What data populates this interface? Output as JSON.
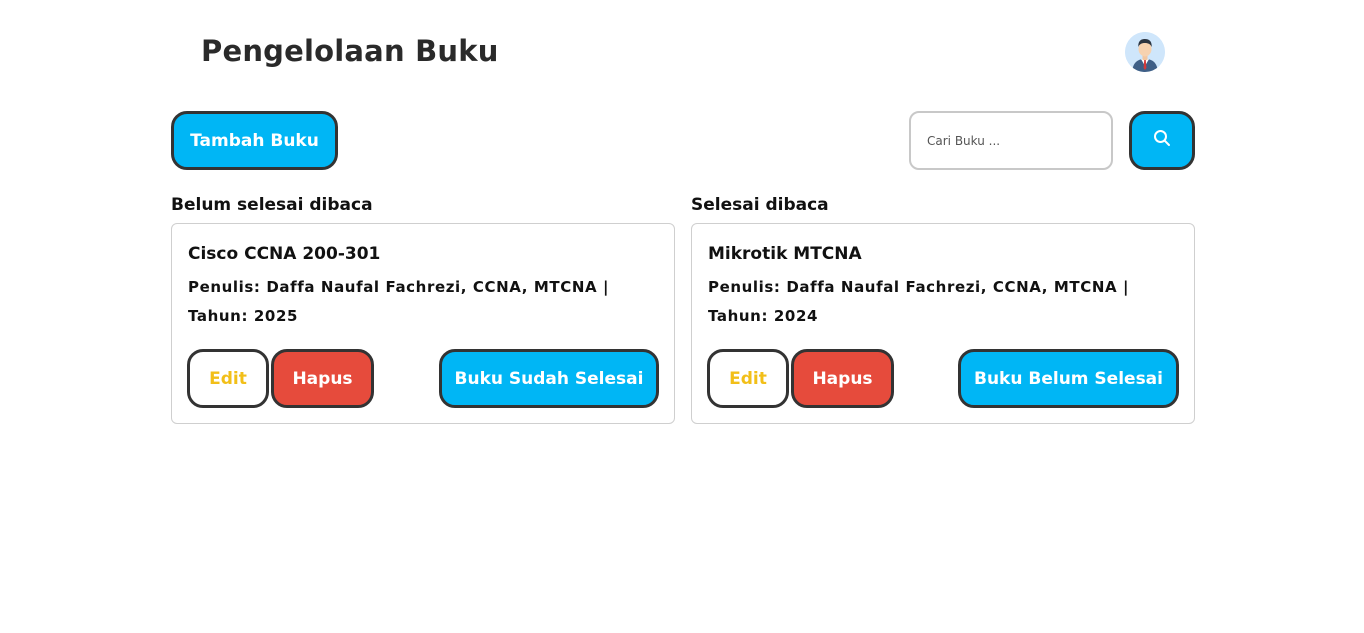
{
  "header": {
    "title": "Pengelolaan Buku",
    "avatar_icon": "user-avatar-icon"
  },
  "toolbar": {
    "add_label": "Tambah Buku",
    "search_placeholder": "Cari Buku ...",
    "search_icon": "search-icon"
  },
  "colors": {
    "primary": "#00b6f5",
    "danger": "#e64b3c",
    "edit_text": "#f2bf18",
    "border": "#333333"
  },
  "sections": [
    {
      "title": "Belum selesai dibaca",
      "books": [
        {
          "title": "Cisco CCNA 200-301",
          "author_line": "Penulis: Daffa Naufal Fachrezi, CCNA, MTCNA |",
          "year_line": "Tahun: 2025",
          "edit_label": "Edit",
          "delete_label": "Hapus",
          "toggle_label": "Buku Sudah Selesai"
        }
      ]
    },
    {
      "title": "Selesai dibaca",
      "books": [
        {
          "title": "Mikrotik MTCNA",
          "author_line": "Penulis: Daffa Naufal Fachrezi, CCNA, MTCNA |",
          "year_line": "Tahun: 2024",
          "edit_label": "Edit",
          "delete_label": "Hapus",
          "toggle_label": "Buku Belum Selesai"
        }
      ]
    }
  ]
}
